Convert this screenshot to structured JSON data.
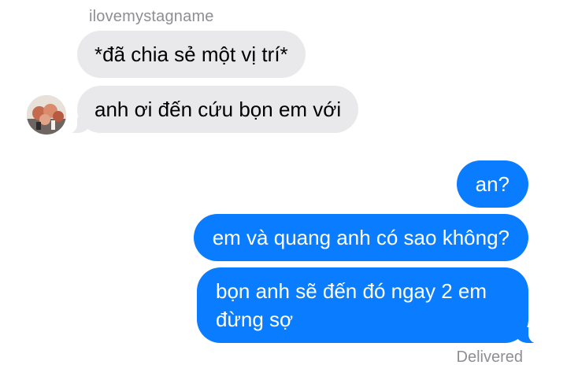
{
  "thread": {
    "sender_name": "ilovemystagname",
    "incoming": [
      {
        "text": "*đã chia sẻ một vị trí*"
      },
      {
        "text": "anh ơi đến cứu bọn em với"
      }
    ],
    "outgoing": [
      {
        "text": "an?"
      },
      {
        "text": "em và quang anh có sao không?"
      },
      {
        "text": "bọn anh sẽ đến đó ngay 2 em đừng sợ"
      }
    ],
    "status": "Delivered"
  },
  "colors": {
    "incoming_bubble": "#e9e9eb",
    "outgoing_bubble": "#0a7cff",
    "meta_text": "#8e8e93"
  },
  "icons": {
    "avatar": "contact-avatar-photo"
  }
}
